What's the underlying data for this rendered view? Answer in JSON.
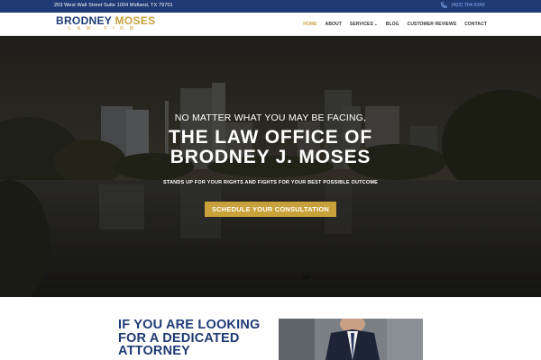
{
  "topbar": {
    "address": "203 West Wall Street Suite 1004 Midland, TX 79701",
    "phone": "(432) 704-5342",
    "phone_icon": "phone-icon"
  },
  "logo": {
    "line1_blue": "BRODNEY",
    "line1_gold": "MOSES",
    "line2": "LAW FIRM"
  },
  "nav": {
    "items": [
      {
        "label": "HOME",
        "active": true
      },
      {
        "label": "ABOUT"
      },
      {
        "label": "SERVICES",
        "has_dropdown": true
      },
      {
        "label": "BLOG"
      },
      {
        "label": "CUSTOMER REVIEWS"
      },
      {
        "label": "CONTACT"
      }
    ]
  },
  "hero": {
    "kicker": "NO MATTER WHAT YOU MAY BE FACING,",
    "title_line1": "THE LAW OFFICE OF",
    "title_line2": "BRODNEY J. MOSES",
    "subtitle": "STANDS UP FOR YOUR RIGHTS AND FIGHTS FOR YOUR BEST POSSIBLE OUTCOME",
    "cta": "SCHEDULE YOUR CONSULTATION"
  },
  "section2": {
    "heading_line1": "IF YOU ARE LOOKING",
    "heading_line2": "FOR A DEDICATED",
    "heading_line3": "ATTORNEY"
  },
  "colors": {
    "navy": "#1f3a74",
    "gold": "#c9a13a",
    "phone_blue": "#8fb2ff"
  }
}
